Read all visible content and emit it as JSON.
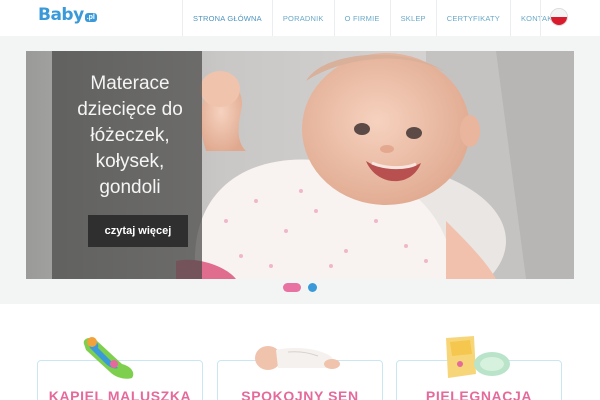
{
  "header": {
    "logo": "Baby",
    "logo_suffix": ".pl",
    "nav": [
      "STRONA GŁÓWNA",
      "PORADNIK",
      "O FIRMIE",
      "SKLEP",
      "CERTYFIKATY",
      "KONTAKT"
    ],
    "language_icon": "poland-flag-icon"
  },
  "hero": {
    "caption": "Materace dziecięce do łóżeczek, kołysek, gondoli",
    "button": "czytaj więcej",
    "slides_count": 2,
    "active_slide": 1
  },
  "categories": [
    {
      "title": "KĄPIEL MALUSZKA",
      "icon": "bath-support-icon"
    },
    {
      "title": "SPOKOJNY SEN",
      "icon": "sleeping-baby-icon"
    },
    {
      "title": "PIELĘGNACJA",
      "icon": "care-pillow-icon"
    }
  ],
  "colors": {
    "brand_blue": "#3a9ad9",
    "accent_pink": "#e56a9b",
    "nav_text": "#6aa9c9",
    "caption_bg": "#4a4a48"
  }
}
